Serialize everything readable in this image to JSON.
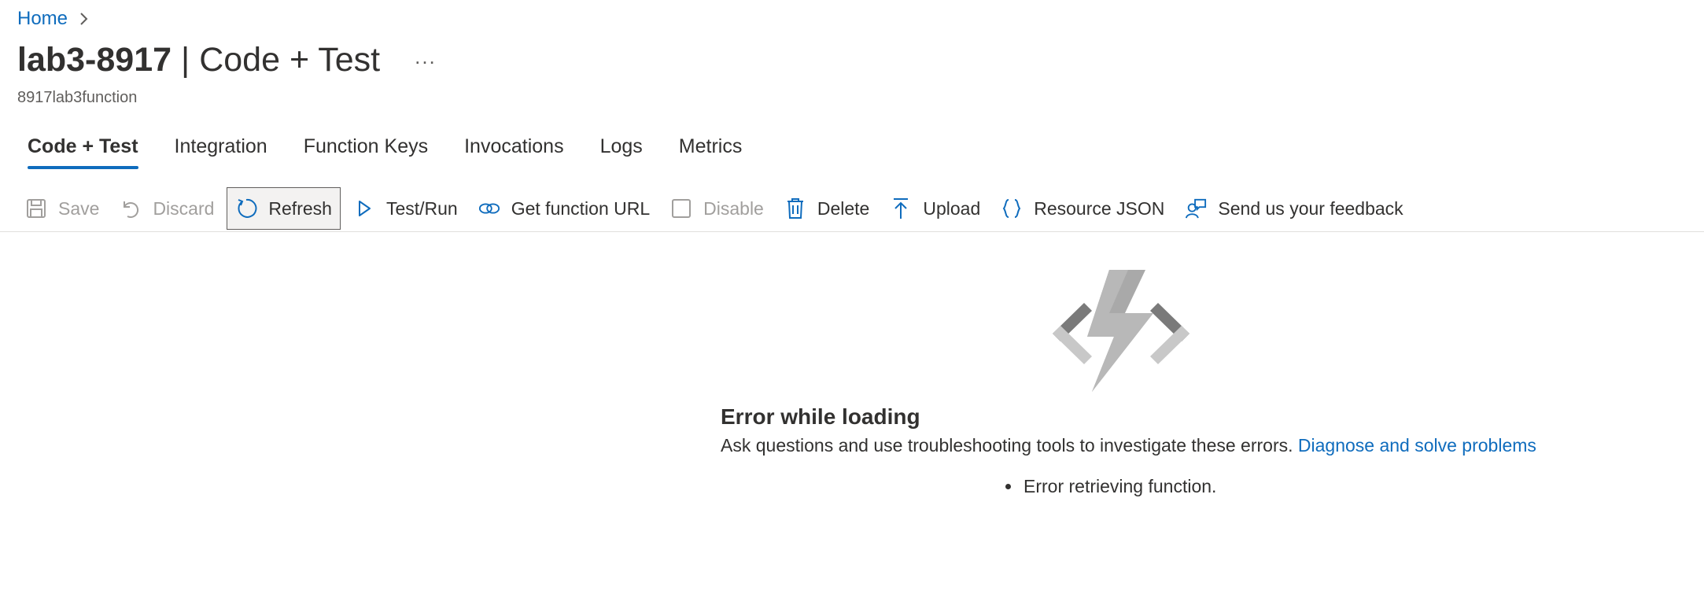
{
  "breadcrumb": {
    "home": "Home"
  },
  "header": {
    "title_bold": "lab3-8917",
    "separator": "|",
    "title_rest": "Code + Test",
    "more": "...",
    "subtitle": "8917lab3function"
  },
  "tabs": [
    {
      "label": "Code + Test",
      "active": true
    },
    {
      "label": "Integration"
    },
    {
      "label": "Function Keys"
    },
    {
      "label": "Invocations"
    },
    {
      "label": "Logs"
    },
    {
      "label": "Metrics"
    }
  ],
  "toolbar": {
    "save": "Save",
    "discard": "Discard",
    "refresh": "Refresh",
    "test_run": "Test/Run",
    "get_url": "Get function URL",
    "disable": "Disable",
    "delete": "Delete",
    "upload": "Upload",
    "resource_json": "Resource JSON",
    "feedback": "Send us your feedback"
  },
  "error": {
    "title": "Error while loading",
    "description": "Ask questions and use troubleshooting tools to investigate these errors.",
    "link": "Diagnose and solve problems",
    "items": [
      "Error retrieving function."
    ]
  },
  "colors": {
    "accent": "#0f6cbd",
    "text": "#323130",
    "disabled": "#a19f9d"
  }
}
